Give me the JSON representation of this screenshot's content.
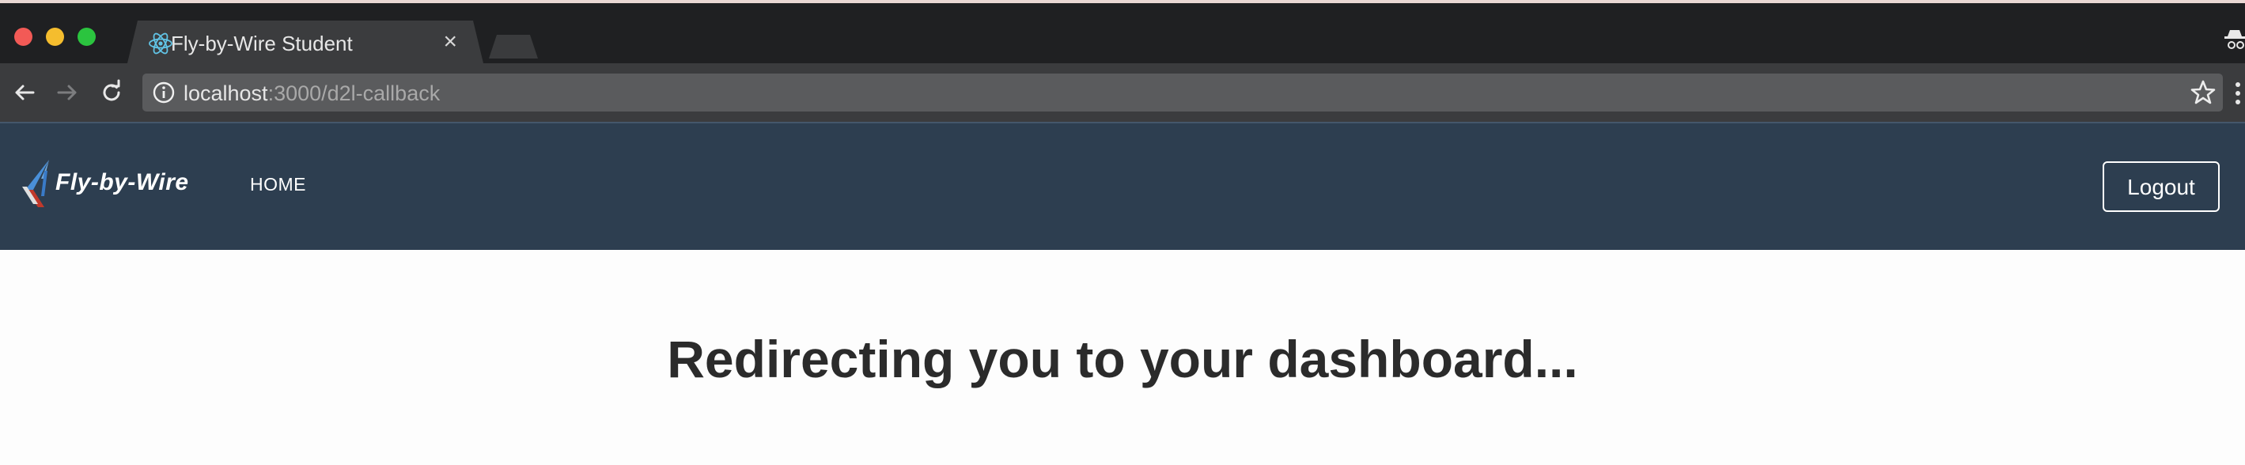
{
  "browser": {
    "tab": {
      "title": "Fly-by-Wire Student",
      "favicon": "react-atom-icon",
      "close_glyph": "×"
    },
    "address_bar": {
      "host": "localhost",
      "rest": ":3000/d2l-callback"
    }
  },
  "navbar": {
    "brand": "Fly-by-Wire",
    "links": [
      {
        "label": "HOME"
      }
    ],
    "logout_label": "Logout"
  },
  "main": {
    "heading": "Redirecting you to your dashboard..."
  },
  "colors": {
    "navbar_bg": "#2d3e50",
    "chrome_dark": "#1f2022",
    "chrome_toolbar": "#3b3c3e",
    "heading_text": "#2b2b2b"
  }
}
